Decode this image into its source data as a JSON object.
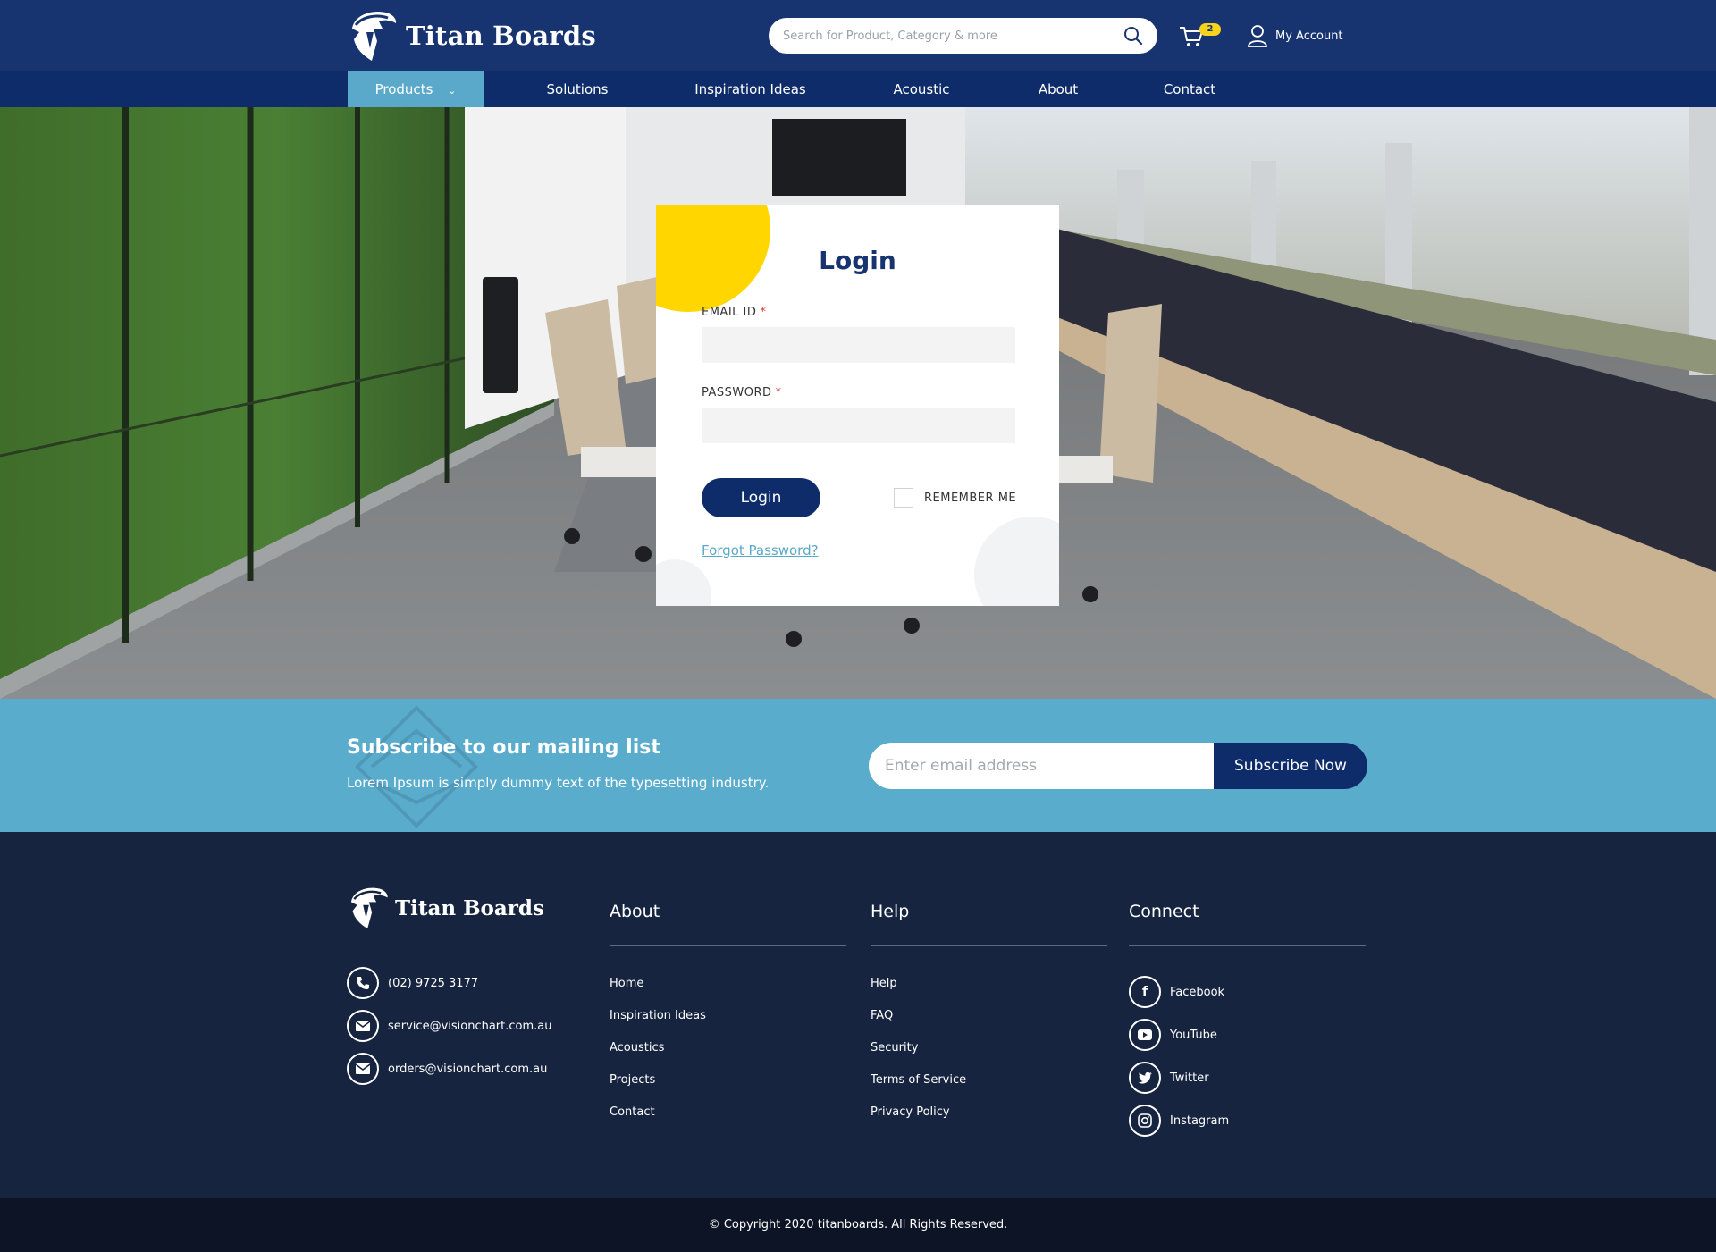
{
  "header": {
    "brand": "Titan Boards",
    "search_placeholder": "Search for Product, Category & more",
    "cart_count": "2",
    "account_label": "My Account"
  },
  "nav": {
    "items": [
      "Products",
      "Solutions",
      "Inspiration Ideas",
      "Acoustic",
      "About",
      "Contact"
    ],
    "active": "Products"
  },
  "login": {
    "title": "Login",
    "email_label": "EMAIL ID",
    "password_label": "PASSWORD",
    "required_mark": "*",
    "login_button": "Login",
    "remember_label": "REMEMBER ME",
    "forgot_link": "Forgot Password?"
  },
  "subscribe": {
    "title": "Subscribe to our mailing list",
    "text": "Lorem Ipsum is simply dummy text of the typesetting industry.",
    "input_placeholder": "Enter email address",
    "button": "Subscribe Now"
  },
  "footer": {
    "brand": "Titan Boards",
    "phone": "(02) 9725 3177",
    "email_service": "service@visionchart.com.au",
    "email_orders": "orders@visionchart.com.au",
    "about_title": "About",
    "about_links": [
      "Home",
      "Inspiration Ideas",
      "Acoustics",
      "Projects",
      "Contact"
    ],
    "help_title": "Help",
    "help_links": [
      "Help",
      "FAQ",
      "Security",
      "Terms of Service",
      "Privacy Policy"
    ],
    "connect_title": "Connect",
    "social": [
      "Facebook",
      "YouTube",
      "Twitter",
      "Instagram"
    ],
    "copyright": "© Copyright 2020 titanboards. All Rights Reserved."
  },
  "colors": {
    "header_bg": "#173370",
    "nav_bg": "#0f2c6a",
    "accent_blue": "#5aa8ca",
    "yellow": "#ffd600",
    "footer_bg": "#172440"
  }
}
